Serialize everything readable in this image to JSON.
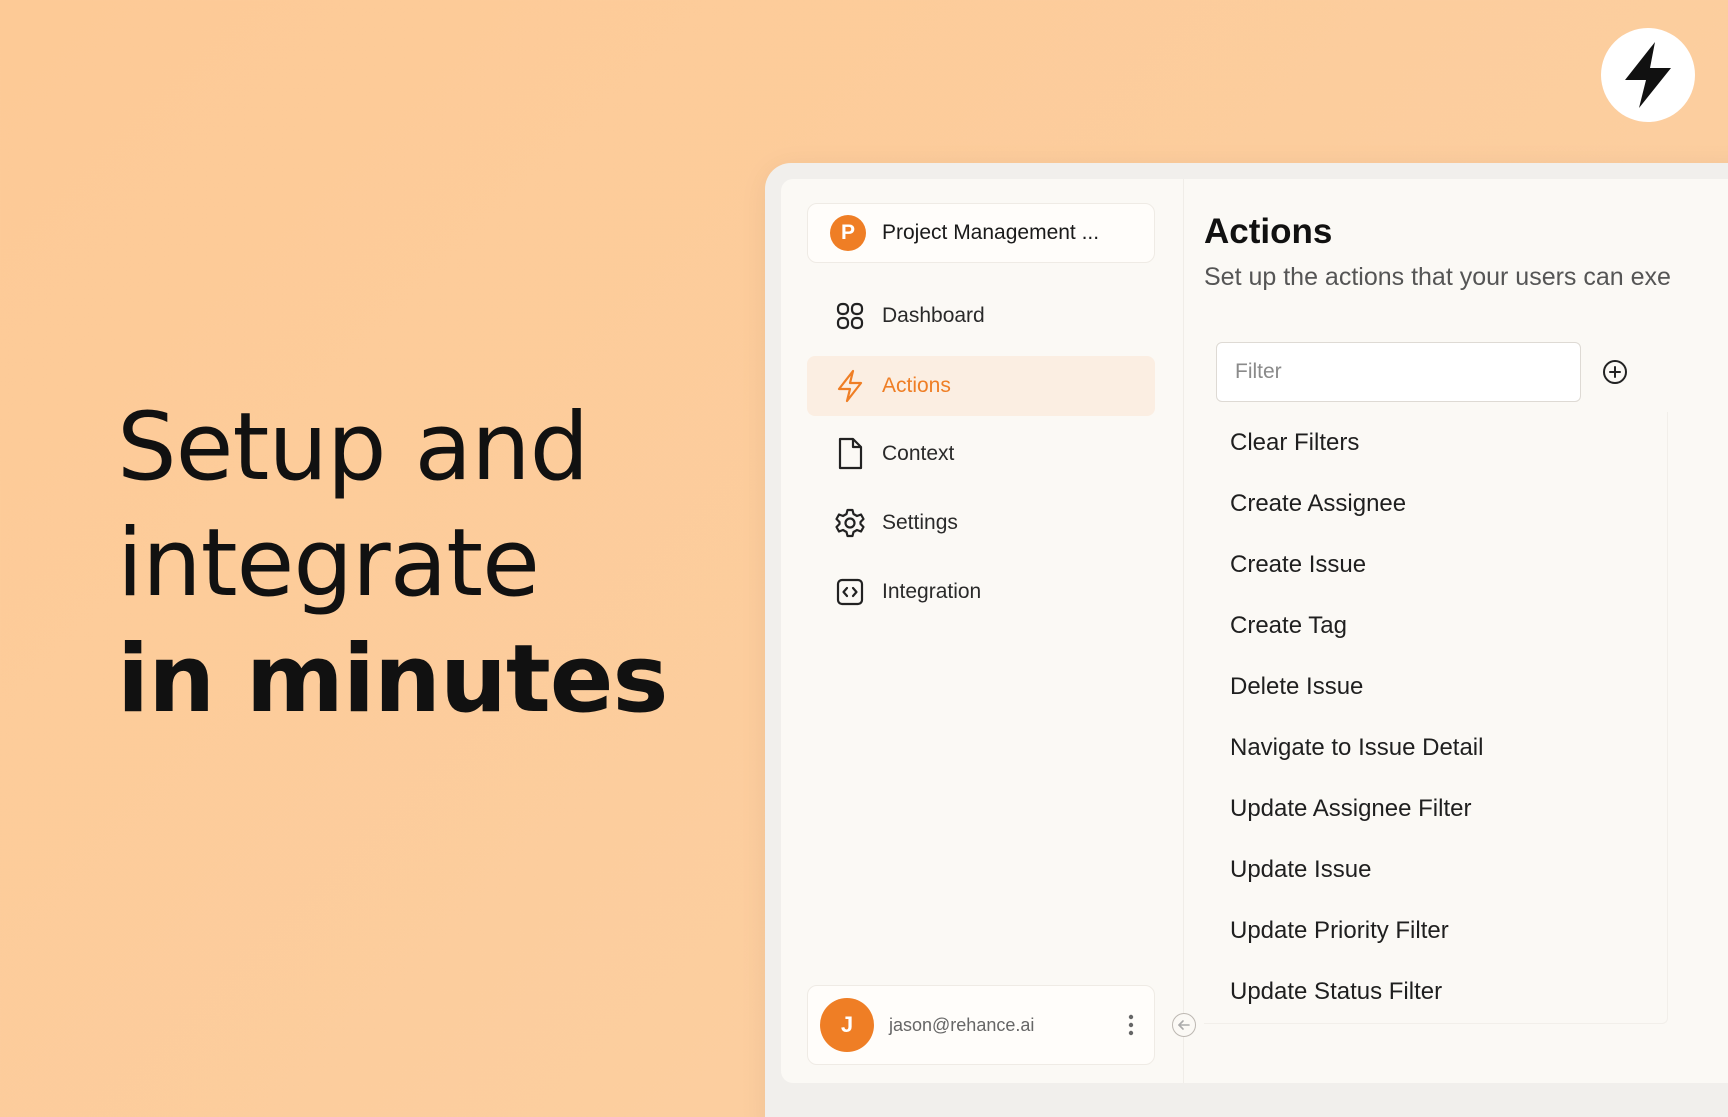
{
  "hero": {
    "line1": "Setup and",
    "line2": "integrate",
    "line3": "in minutes"
  },
  "badge": {
    "icon": "lightning-bolt-icon"
  },
  "sidebar": {
    "project": {
      "initial": "P",
      "name": "Project Management ..."
    },
    "items": [
      {
        "label": "Dashboard",
        "icon": "grid-icon",
        "active": false
      },
      {
        "label": "Actions",
        "icon": "lightning-bolt-icon",
        "active": true
      },
      {
        "label": "Context",
        "icon": "document-icon",
        "active": false
      },
      {
        "label": "Settings",
        "icon": "gear-icon",
        "active": false
      },
      {
        "label": "Integration",
        "icon": "code-brackets-icon",
        "active": false
      }
    ],
    "user": {
      "initial": "J",
      "email": "jason@rehance.ai"
    }
  },
  "main": {
    "title": "Actions",
    "subtitle": "Set up the actions that your users can exe",
    "filter": {
      "placeholder": "Filter",
      "value": ""
    },
    "actions": [
      "Clear Filters",
      "Create Assignee",
      "Create Issue",
      "Create Tag",
      "Delete Issue",
      "Navigate to Issue Detail",
      "Update Assignee Filter",
      "Update Issue",
      "Update Priority Filter",
      "Update Status Filter"
    ]
  },
  "colors": {
    "accent": "#ef7e25",
    "background": "#fdca96",
    "active_bg": "#fbeee2"
  }
}
